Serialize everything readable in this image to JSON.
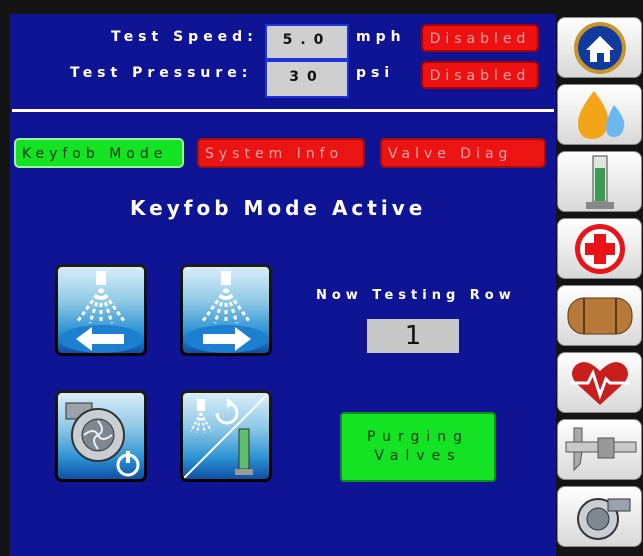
{
  "header": {
    "speed_label": "Test Speed:",
    "speed_value": "5.0",
    "speed_unit": "mph",
    "speed_status": "Disabled",
    "pressure_label": "Test Pressure:",
    "pressure_value": "30",
    "pressure_unit": "psi",
    "pressure_status": "Disabled"
  },
  "tabs": [
    {
      "label": "Keyfob Mode",
      "active": true
    },
    {
      "label": "System Info",
      "active": false
    },
    {
      "label": "Valve Diag",
      "active": false
    }
  ],
  "main": {
    "title": "Keyfob Mode Active",
    "testing_label": "Now Testing Row",
    "row_value": "1",
    "purge_line1": "Purging",
    "purge_line2": "Valves"
  },
  "controls": [
    {
      "icon": "spray-left-icon"
    },
    {
      "icon": "spray-right-icon"
    },
    {
      "icon": "pump-power-icon"
    },
    {
      "icon": "rinse-flowmeter-icon"
    }
  ],
  "sidebar": [
    {
      "icon": "home-icon"
    },
    {
      "icon": "fuel-water-drops-icon"
    },
    {
      "icon": "flow-tube-icon"
    },
    {
      "icon": "first-aid-cross-icon"
    },
    {
      "icon": "tank-icon"
    },
    {
      "icon": "heartbeat-icon"
    },
    {
      "icon": "caliper-icon"
    },
    {
      "icon": "pump-icon"
    }
  ],
  "colors": {
    "background": "#0f1494",
    "active_green": "#14e324",
    "disabled_red": "#ee1111",
    "value_box": "#cfcfcf"
  }
}
